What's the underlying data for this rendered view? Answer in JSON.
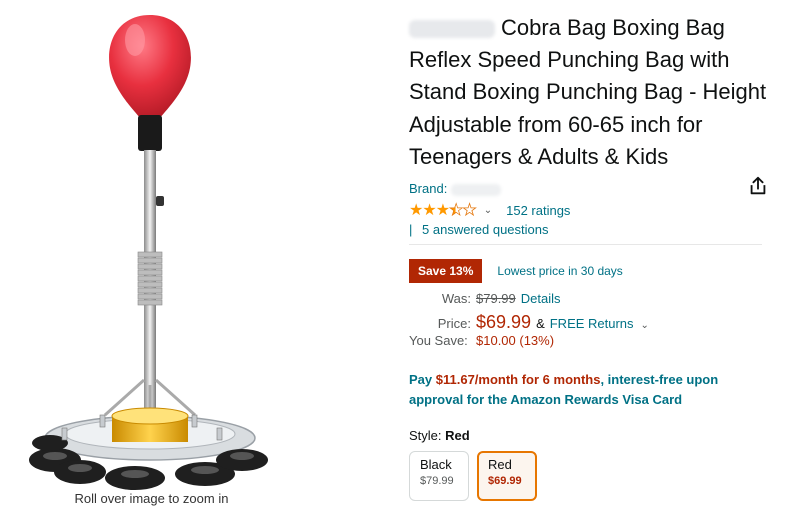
{
  "product": {
    "title_partial": "Cobra Bag Boxing Bag Reflex Speed Punching Bag with Stand Boxing Punching Bag - Height Adjustable from 60-65 inch for Teenagers & Adults & Kids",
    "brand_label": "Brand:",
    "rating_stars": 3.5,
    "ratings_count": "152 ratings",
    "answered_questions": "5 answered questions"
  },
  "image": {
    "zoom_hint": "Roll over image to zoom in"
  },
  "deal": {
    "badge": "Save 13%",
    "lowest": "Lowest price in 30 days"
  },
  "pricing": {
    "was_label": "Was:",
    "was_value": "$79.99",
    "details": "Details",
    "price_label": "Price:",
    "price_value": "$69.99",
    "amp": "&",
    "free_returns": "FREE Returns",
    "you_save_label": "You Save:",
    "you_save_value": "$10.00 (13%)"
  },
  "financing": {
    "pre": "Pay ",
    "amount": "$11.67/month for 6 months",
    "post": ", interest-free upon approval for the Amazon Rewards Visa Card"
  },
  "style": {
    "label": "Style:",
    "selected": "Red",
    "options": [
      {
        "name": "Black",
        "price": "$79.99"
      },
      {
        "name": "Red",
        "price": "$69.99"
      }
    ]
  },
  "colors": {
    "accent_link": "#007185",
    "price_red": "#b12704",
    "star": "#ff9900",
    "selected_border": "#e77600"
  }
}
